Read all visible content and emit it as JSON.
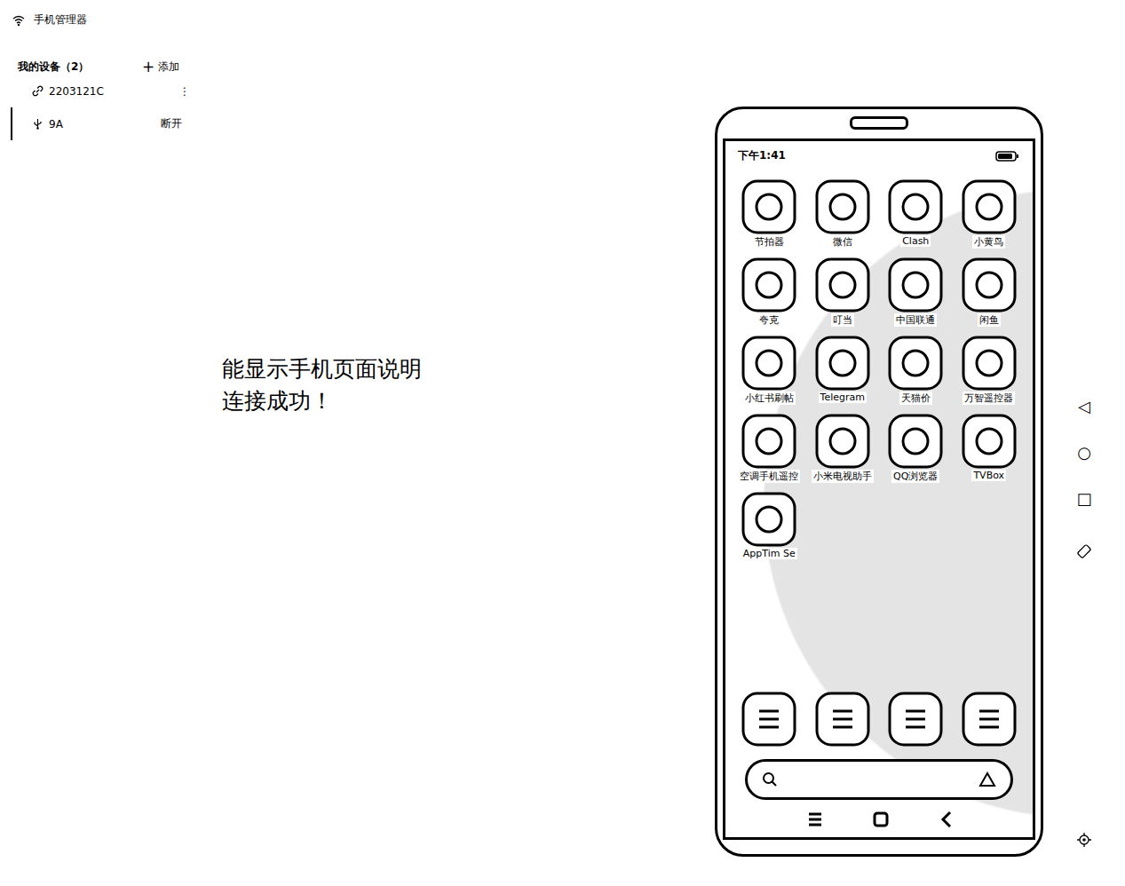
{
  "window": {
    "title": "手机管理器"
  },
  "devices_header": {
    "title": "我的设备（2）",
    "add_icon": "+",
    "add_label": "添加"
  },
  "devices": [
    {
      "name": "2203121C",
      "kind": "wireless",
      "selected": false,
      "action": "⋮"
    },
    {
      "name": "9A",
      "kind": "usb",
      "selected": true,
      "action": "断开"
    }
  ],
  "message": [
    "能显示手机页面说明",
    "连接成功！"
  ],
  "phone": {
    "status_time": "下午1:41",
    "apps": [
      "节拍器",
      "微信",
      "Clash",
      "小黄鸟",
      "夸克",
      "叮当",
      "中国联通",
      "闲鱼",
      "小红书刷帖",
      "Telegram",
      "天猫价",
      "万智遥控器",
      "空调手机遥控",
      "小米电视助手",
      "QQ浏览器",
      "TVBox",
      "AppTim Se"
    ],
    "dock_count": 4
  },
  "controls": [
    "◁",
    "○",
    "□"
  ]
}
